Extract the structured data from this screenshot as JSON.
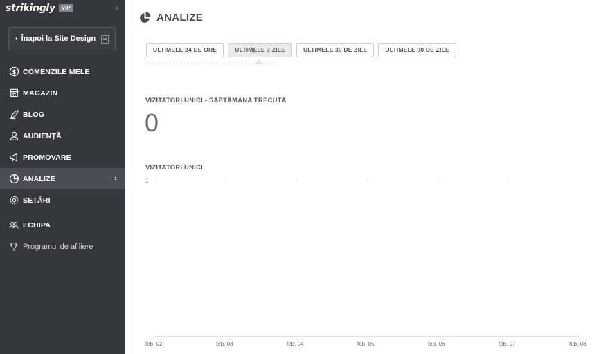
{
  "sidebar": {
    "brand": "strikingly",
    "badge": "VIP",
    "back_label": "Înapoi la Site Design",
    "items": [
      {
        "label": "COMENZILE MELE",
        "icon": "dollar-circle-icon"
      },
      {
        "label": "MAGAZIN",
        "icon": "store-icon"
      },
      {
        "label": "BLOG",
        "icon": "quill-icon"
      },
      {
        "label": "AUDIENȚĂ",
        "icon": "audience-icon"
      },
      {
        "label": "PROMOVARE",
        "icon": "megaphone-icon"
      },
      {
        "label": "ANALIZE",
        "icon": "pie-chart-icon",
        "active": true
      },
      {
        "label": "SETĂRI",
        "icon": "gear-icon"
      },
      {
        "label": "ECHIPA",
        "icon": "team-icon"
      },
      {
        "label": "Programul de afiliere",
        "icon": "trophy-icon"
      }
    ]
  },
  "main": {
    "title": "ANALIZE",
    "tabs": [
      {
        "label": "ULTIMELE 24 DE ORE"
      },
      {
        "label": "ULTIMELE 7 ZILE",
        "active": true
      },
      {
        "label": "ULTIMELE 30 DE ZILE"
      },
      {
        "label": "ULTIMELE 90 DE ZILE"
      }
    ],
    "weekly_label": "VIZITATORI UNICI - SĂPTĂMÂNA TRECUTĂ",
    "weekly_value": "0",
    "chart_label": "VIZITATORI UNICI"
  },
  "colors": {
    "sidebar_bg": "#34373b",
    "active_item_bg": "#4a4e54",
    "axis": "#cfd3d6"
  },
  "chart_data": {
    "type": "line",
    "title": "VIZITATORI UNICI",
    "categories": [
      "feb. 02",
      "feb. 03",
      "feb. 04",
      "feb. 05",
      "feb. 06",
      "feb. 07",
      "feb. 08"
    ],
    "series": [
      {
        "values": [
          0,
          0,
          0,
          0,
          0,
          0,
          0
        ]
      }
    ],
    "yticks": [
      "1"
    ],
    "ylim": [
      0,
      1
    ],
    "grid": true
  }
}
